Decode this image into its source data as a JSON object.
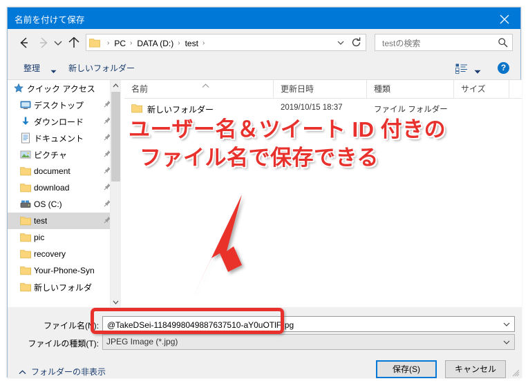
{
  "window": {
    "title": "名前を付けて保存",
    "close_icon": "close-icon"
  },
  "navigation": {
    "back_icon": "arrow-left-icon",
    "forward_icon": "arrow-right-icon",
    "recent_icon": "chevron-down-icon",
    "up_icon": "arrow-up-icon",
    "address_folder_icon": "folder-icon",
    "breadcrumbs": [
      "PC",
      "DATA (D:)",
      "test"
    ],
    "breadcrumb_separator": "›",
    "address_dropdown_icon": "chevron-down-icon",
    "refresh_icon": "refresh-icon"
  },
  "search": {
    "placeholder": "testの検索",
    "value": "",
    "icon": "search-icon"
  },
  "toolbar": {
    "organize_label": "整理",
    "organize_caret": "caret-down-icon",
    "new_folder_label": "新しいフォルダー",
    "view_icon": "view-layout-icon",
    "view_caret": "caret-down-icon",
    "help_label": "?",
    "help_icon": "help-icon"
  },
  "sidebar": {
    "items": [
      {
        "label": "クイック アクセス",
        "icon": "star-icon",
        "pinned": false,
        "indent": false,
        "selected": false
      },
      {
        "label": "デスクトップ",
        "icon": "desktop-icon",
        "pinned": true,
        "indent": true,
        "selected": false
      },
      {
        "label": "ダウンロード",
        "icon": "download-icon",
        "pinned": true,
        "indent": true,
        "selected": false
      },
      {
        "label": "ドキュメント",
        "icon": "document-icon",
        "pinned": true,
        "indent": true,
        "selected": false
      },
      {
        "label": "ピクチャ",
        "icon": "picture-icon",
        "pinned": true,
        "indent": true,
        "selected": false
      },
      {
        "label": "document",
        "icon": "folder-icon",
        "pinned": true,
        "indent": true,
        "selected": false
      },
      {
        "label": "download",
        "icon": "folder-icon",
        "pinned": true,
        "indent": true,
        "selected": false
      },
      {
        "label": "OS (C:)",
        "icon": "drive-icon",
        "pinned": true,
        "indent": true,
        "selected": false
      },
      {
        "label": "test",
        "icon": "folder-icon",
        "pinned": true,
        "indent": true,
        "selected": true
      },
      {
        "label": "pic",
        "icon": "folder-icon",
        "pinned": false,
        "indent": true,
        "selected": false
      },
      {
        "label": "recovery",
        "icon": "folder-icon",
        "pinned": false,
        "indent": true,
        "selected": false
      },
      {
        "label": "Your-Phone-Syn",
        "icon": "folder-icon",
        "pinned": false,
        "indent": true,
        "selected": false
      },
      {
        "label": "新しいフォルダ",
        "icon": "folder-icon",
        "pinned": false,
        "indent": true,
        "selected": false
      }
    ],
    "scroll_up_icon": "chevron-up-icon",
    "scroll_down_icon": "chevron-down-icon"
  },
  "filelist": {
    "columns": [
      "名前",
      "更新日時",
      "種類",
      "サイズ"
    ],
    "sort_indicator_icon": "caret-up-icon",
    "rows": [
      {
        "name": "新しいフォルダー",
        "icon": "folder-icon",
        "date": "2019/10/15 18:37",
        "type": "ファイル フォルダー",
        "size": ""
      }
    ]
  },
  "form": {
    "filename_label": "ファイル名(N):",
    "filename_value": "@TakeDSei-1184998049887637510-aY0uOTlF.jpg",
    "filename_caret_icon": "chevron-down-icon",
    "filetype_label": "ファイルの種類(T):",
    "filetype_value": "JPEG Image (*.jpg)",
    "filetype_caret_icon": "chevron-down-icon",
    "hide_folders_label": "フォルダーの非表示",
    "hide_folders_caret_icon": "chevron-up-icon",
    "save_label": "保存(S)",
    "cancel_label": "キャンセル",
    "resize_grip_icon": "resize-grip-icon"
  },
  "annotation": {
    "line1": "ユーザー名＆ツイート ID 付きの",
    "line2": "ファイル名で保存できる",
    "arrow_icon": "arrow-down-left-icon",
    "highlight_icon": "highlight-box",
    "color": "#e8312c"
  },
  "colors": {
    "titlebar": "#0078d7",
    "accent_red": "#e8312c",
    "dialog_bg": "#f0f0f0",
    "focus_blue": "#0078d7",
    "folder_yellow": "#fbd57a"
  }
}
